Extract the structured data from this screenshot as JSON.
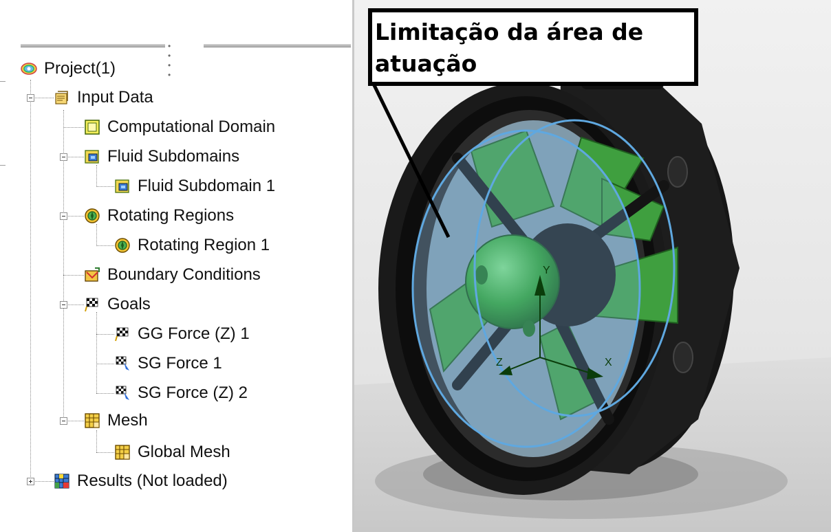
{
  "tree": {
    "items": [
      {
        "label": "Project(1)",
        "icon": "project-icon"
      },
      {
        "label": "Input Data",
        "icon": "input-data-icon"
      },
      {
        "label": "Computational Domain",
        "icon": "computational-domain-icon"
      },
      {
        "label": "Fluid Subdomains",
        "icon": "fluid-subdomains-icon"
      },
      {
        "label": "Fluid Subdomain 1",
        "icon": "fluid-subdomain-icon"
      },
      {
        "label": "Rotating Regions",
        "icon": "rotating-regions-icon"
      },
      {
        "label": "Rotating Region 1",
        "icon": "rotating-region-icon"
      },
      {
        "label": "Boundary Conditions",
        "icon": "boundary-conditions-icon"
      },
      {
        "label": "Goals",
        "icon": "goals-icon"
      },
      {
        "label": "GG Force (Z) 1",
        "icon": "global-goal-icon"
      },
      {
        "label": "SG Force 1",
        "icon": "surface-goal-icon"
      },
      {
        "label": "SG Force (Z) 2",
        "icon": "surface-goal-icon"
      },
      {
        "label": "Mesh",
        "icon": "mesh-icon"
      },
      {
        "label": "Global Mesh",
        "icon": "global-mesh-icon"
      },
      {
        "label": "Results (Not loaded)",
        "icon": "results-icon"
      }
    ]
  },
  "viewport": {
    "callout_text": "Limitação da área de atuação",
    "axis_labels": {
      "y": "Y",
      "z": "Z",
      "x": "X"
    }
  },
  "colors": {
    "rotor_green": "#2e9e2e",
    "domain_blue": "#5fa8e0",
    "housing_black": "#1a1a1a",
    "callout_border": "#000000"
  }
}
